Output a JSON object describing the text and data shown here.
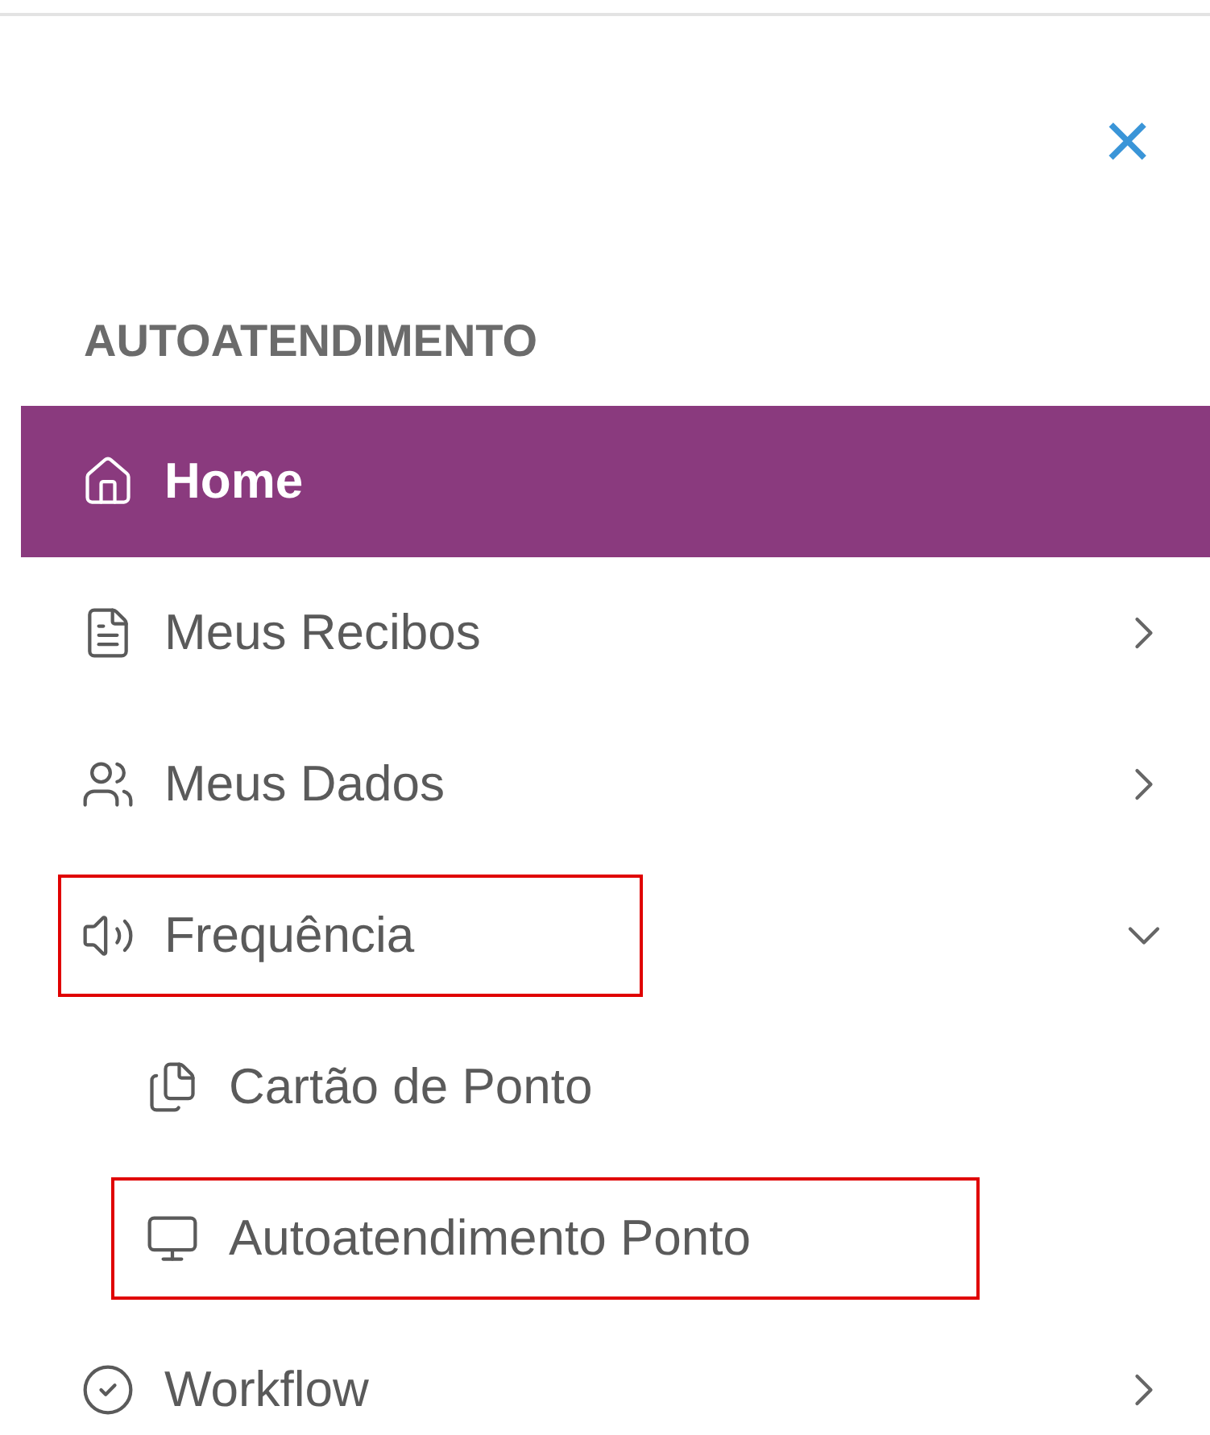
{
  "close_label": "×",
  "section": "AUTOATENDIMENTO",
  "menu": [
    {
      "label": "Home",
      "selected": true,
      "highlighted": false
    },
    {
      "label": "Meus Recibos",
      "selected": false,
      "expanded": false,
      "highlighted": false
    },
    {
      "label": "Meus Dados",
      "selected": false,
      "expanded": false,
      "highlighted": false
    },
    {
      "label": "Frequência",
      "selected": false,
      "expanded": true,
      "highlighted": true,
      "children": [
        {
          "label": "Cartão de Ponto",
          "selected": false,
          "highlighted": false
        },
        {
          "label": "Autoatendimento Ponto",
          "selected": false,
          "highlighted": true
        }
      ]
    },
    {
      "label": "Workflow",
      "selected": false,
      "expanded": false,
      "highlighted": false
    }
  ]
}
